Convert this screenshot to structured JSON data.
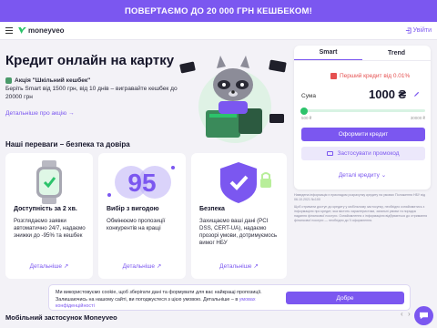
{
  "promo": {
    "text": "ПОВЕРТАЄМО ДО 20 000 ГРН КЕШБЕКОМ!"
  },
  "nav": {
    "logo": "moneyveo",
    "login": "Увійти"
  },
  "hero": {
    "title": "Кредит онлайн на картку",
    "action_title": "Акція \"Шкільний кешбек\"",
    "action_text": "Беріть Smart від 1500 грн, від 10 днів – вигравайте кешбек до 20000 грн",
    "action_link": "Детальніше про акцію"
  },
  "calc": {
    "tabs": [
      "Smart",
      "Trend"
    ],
    "first_credit": "Перший кредит від 0.01%",
    "sum_label": "Сума",
    "sum_value": "1000 ₴",
    "min": "500 ₴",
    "max": "30000 ₴",
    "slider_fraction": 0.02,
    "apply_button": "Оформити кредит",
    "promo_button": "Застосувати промокод",
    "details_link": "Деталі кредиту"
  },
  "legal": [
    "Наведена інформація є прикладом розрахунку кредиту на умовах Положення НБУ від 06.10.2021 №100",
    "Щоб отримати доступ до кредиту у мобільному застосунку, необхідно ознайомитись з інформацією про кредит, яка містить характеристики, загальні умови та порядок надання фінансової послуги. Ознайомлення з інформацією відбувається до отримання фінансової послуги — необхідно до її оформлення."
  ],
  "advantages": {
    "title": "Наші переваги – безпека та довіра",
    "items": [
      {
        "title": "Доступність за 2 хв.",
        "text": "Розглядаємо заявки автоматично 24/7, надаємо знижки до -95% та кешбек",
        "link": "Детальніше"
      },
      {
        "title": "Вибір з вигодою",
        "text": "Обмінюємо пропозиції конкурентів на кращі",
        "link": "Детальніше"
      },
      {
        "title": "Безпека",
        "text": "Захищаємо ваші дані (PCI DSS, CERT-UA), надаємо прозорі умови, дотримуємось вимог НБУ",
        "link": "Детальніше"
      }
    ],
    "badge_95": "95"
  },
  "cookie": {
    "text": "Ми використовуємо cookie, щоб зберігати дані та формувати для вас найкращі пропозиції. Залишаючись на нашому сайті, ви погоджуєтеся з цією умовою. Детальніше – в ",
    "link": "умовах конфіденційності",
    "button": "Добре"
  },
  "mobile": {
    "title": "Мобільний застосунок Moneyveo"
  },
  "colors": {
    "accent": "#7b57f0",
    "green": "#2cc36b",
    "bg": "#f3f2f7"
  }
}
